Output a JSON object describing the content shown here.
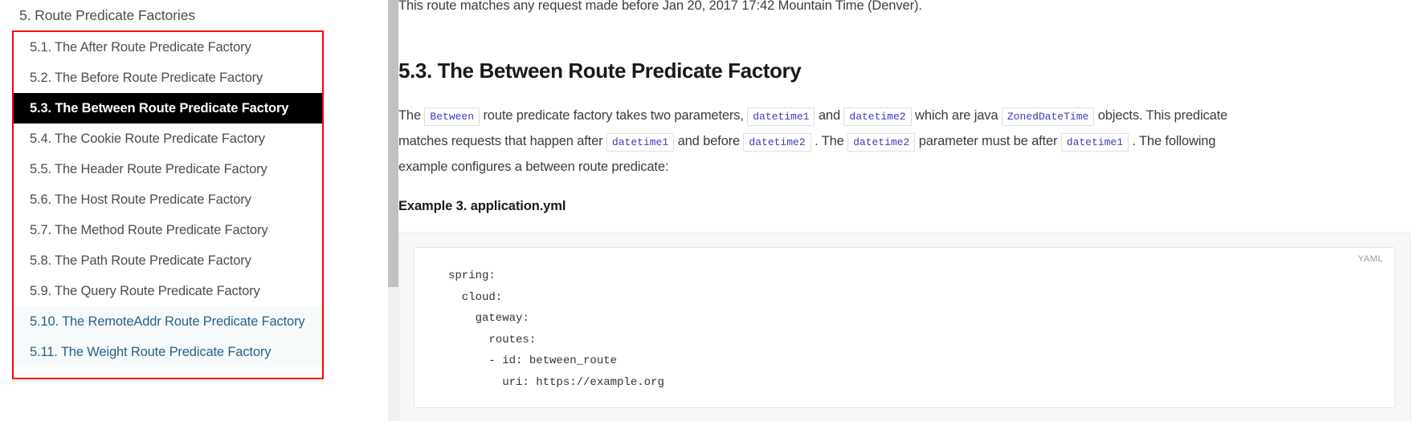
{
  "sidebar": {
    "heading": "5. Route Predicate Factories",
    "items": [
      {
        "label": "5.1. The After Route Predicate Factory",
        "state": "normal"
      },
      {
        "label": "5.2. The Before Route Predicate Factory",
        "state": "normal"
      },
      {
        "label": "5.3. The Between Route Predicate Factory",
        "state": "active"
      },
      {
        "label": "5.4. The Cookie Route Predicate Factory",
        "state": "normal"
      },
      {
        "label": "5.5. The Header Route Predicate Factory",
        "state": "normal"
      },
      {
        "label": "5.6. The Host Route Predicate Factory",
        "state": "normal"
      },
      {
        "label": "5.7. The Method Route Predicate Factory",
        "state": "normal"
      },
      {
        "label": "5.8. The Path Route Predicate Factory",
        "state": "normal"
      },
      {
        "label": "5.9. The Query Route Predicate Factory",
        "state": "normal"
      },
      {
        "label": "5.10. The RemoteAddr Route Predicate Factory",
        "state": "link"
      },
      {
        "label": "5.11. The Weight Route Predicate Factory",
        "state": "link"
      }
    ],
    "highlight_box_color": "#fe0000",
    "active_bg": "#000000",
    "link_color": "#2b6089"
  },
  "scrollbar": {
    "track_color": "#f1f1f1",
    "thumb_color": "#c1c1c1"
  },
  "main": {
    "lede": "This route matches any request made before Jan 20, 2017 17:42 Mountain Time (Denver).",
    "section_title": "5.3. The Between Route Predicate Factory",
    "paragraph": {
      "t1": "The ",
      "c1": "Between",
      "t2": " route predicate factory takes two parameters, ",
      "c2": "datetime1",
      "t3": " and ",
      "c3": "datetime2",
      "t4": " which are java ",
      "c4": "ZonedDateTime",
      "t5": " objects. This predicate matches requests that happen after ",
      "c5": "datetime1",
      "t6": " and before ",
      "c6": "datetime2",
      "t7": " . The ",
      "c7": "datetime2",
      "t8": " parameter must be after ",
      "c8": "datetime1",
      "t9": " . The following example configures a between route predicate:"
    },
    "example_title": "Example 3. application.yml",
    "code_language_badge": "YAML",
    "code": "spring:\n  cloud:\n    gateway:\n      routes:\n      - id: between_route\n        uri: https://example.org"
  }
}
